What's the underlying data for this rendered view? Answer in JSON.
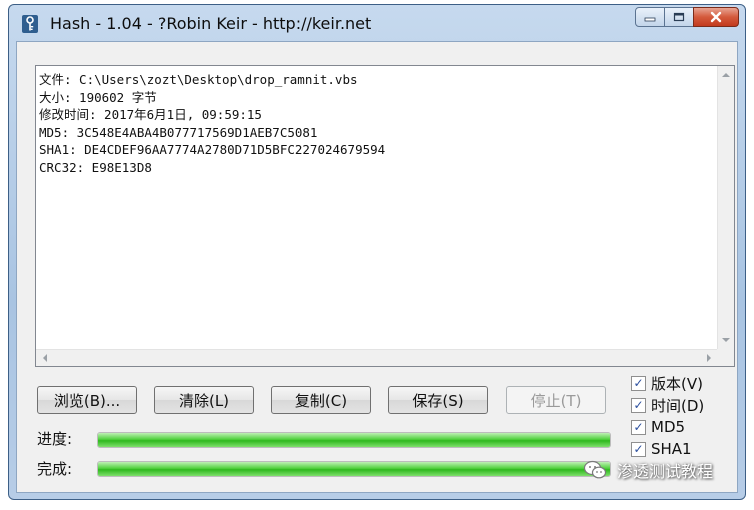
{
  "window": {
    "title": "Hash - 1.04 - ?Robin Keir - http://keir.net"
  },
  "output": {
    "lines": [
      "文件: C:\\Users\\zozt\\Desktop\\drop_ramnit.vbs",
      "大小: 190602 字节",
      "修改时间: 2017年6月1日, 09:59:15",
      "MD5: 3C548E4ABA4B077717569D1AEB7C5081",
      "SHA1: DE4CDEF96AA7774A2780D71D5BFC227024679594",
      "CRC32: E98E13D8"
    ]
  },
  "buttons": {
    "browse": "浏览(B)...",
    "clear": "清除(L)",
    "copy": "复制(C)",
    "save": "保存(S)",
    "stop": "停止(T)"
  },
  "progress": {
    "progress_label": "进度:",
    "progress_value": 1.0,
    "complete_label": "完成:",
    "complete_value": 1.0,
    "fill_color": "#3cc62a"
  },
  "options": [
    {
      "label": "版本(V)",
      "checked": true
    },
    {
      "label": "时间(D)",
      "checked": true
    },
    {
      "label": "MD5",
      "checked": true
    },
    {
      "label": "SHA1",
      "checked": true
    }
  ],
  "watermark": {
    "text": "渗透测试教程",
    "icon": "wechat-icon"
  }
}
